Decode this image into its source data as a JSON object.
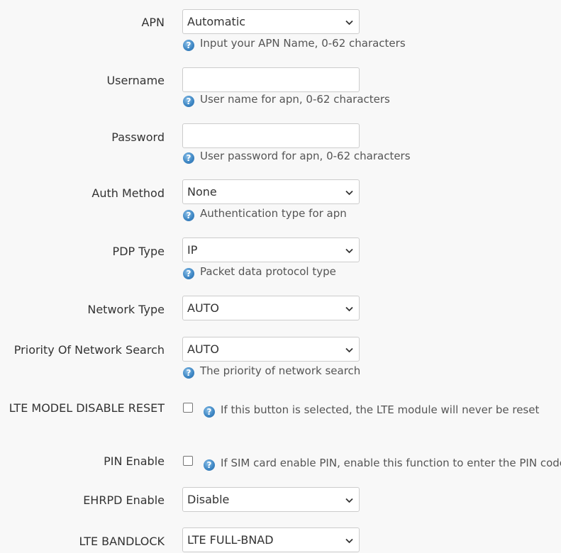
{
  "fields": {
    "apn": {
      "label": "APN",
      "value": "Automatic",
      "hint": "Input your APN Name, 0-62 characters"
    },
    "username": {
      "label": "Username",
      "value": "",
      "hint": "User name for apn, 0-62 characters"
    },
    "password": {
      "label": "Password",
      "value": "",
      "hint": "User password for apn, 0-62 characters"
    },
    "auth_method": {
      "label": "Auth Method",
      "value": "None",
      "hint": "Authentication type for apn"
    },
    "pdp_type": {
      "label": "PDP Type",
      "value": "IP",
      "hint": "Packet data protocol type"
    },
    "network_type": {
      "label": "Network Type",
      "value": "AUTO"
    },
    "priority": {
      "label": "Priority Of Network Search",
      "value": "AUTO",
      "hint": "The priority of network search"
    },
    "lte_reset": {
      "label": "LTE MODEL DISABLE RESET",
      "checked": false,
      "hint": "If this button is selected, the LTE module will never be reset"
    },
    "pin_enable": {
      "label": "PIN Enable",
      "checked": false,
      "hint": "If SIM card enable PIN, enable this function to enter the PIN code"
    },
    "ehrpd": {
      "label": "EHRPD Enable",
      "value": "Disable"
    },
    "lte_bandlock": {
      "label": "LTE BANDLOCK",
      "value": "LTE FULL-BNAD"
    }
  },
  "icons": {
    "help": "question-circle-icon",
    "dropdown": "chevron-down-icon"
  },
  "colors": {
    "help_icon": "#3f88c5",
    "background": "#f8f8f8",
    "border": "#cccccc"
  }
}
